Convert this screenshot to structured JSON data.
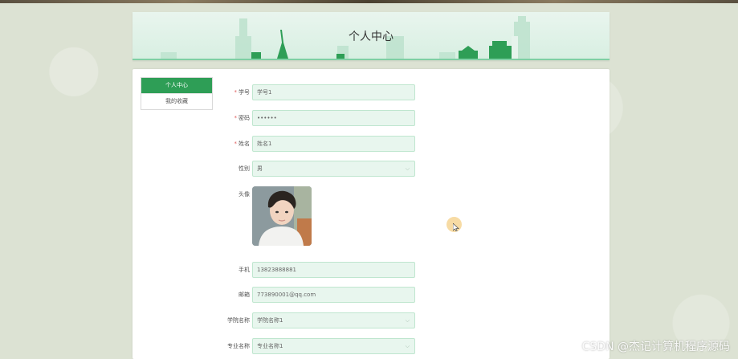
{
  "banner": {
    "title": "个人中心"
  },
  "side_menu": {
    "items": [
      {
        "label": "个人中心",
        "active": true
      },
      {
        "label": "我的收藏",
        "active": false
      }
    ]
  },
  "form": {
    "student_id": {
      "label": "学号",
      "required": true,
      "value": "学号1"
    },
    "password": {
      "label": "密码",
      "required": true,
      "value": "••••••"
    },
    "name": {
      "label": "姓名",
      "required": true,
      "value": "姓名1"
    },
    "gender": {
      "label": "性别",
      "value": "男"
    },
    "avatar": {
      "label": "头像"
    },
    "phone": {
      "label": "手机",
      "value": "13823888881"
    },
    "email": {
      "label": "邮箱",
      "value": "773890001@qq.com"
    },
    "college": {
      "label": "学院名称",
      "value": "学院名称1"
    },
    "major": {
      "label": "专业名称",
      "value": "专业名称1"
    }
  },
  "watermark": "CSDN @杰记计算机程序源码",
  "colors": {
    "accent": "#2e9e56",
    "input_bg": "#e8f6ee",
    "input_border": "#bfe6cf",
    "required": "#e06060"
  }
}
